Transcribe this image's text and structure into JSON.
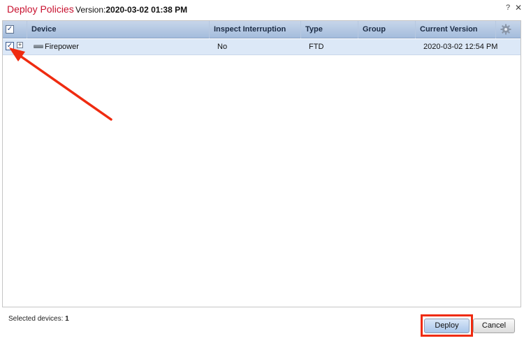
{
  "window": {
    "title": "Deploy Policies",
    "version_label": "Version:",
    "version_value": "2020-03-02 01:38 PM",
    "help_glyph": "?",
    "close_glyph": "✕"
  },
  "grid": {
    "select_all_checked": true,
    "check_glyph": "✓",
    "columns": [
      "Device",
      "Inspect Interruption",
      "Type",
      "Group",
      "Current Version"
    ],
    "rows": [
      {
        "checked": true,
        "device": "Firepower",
        "inspect_interruption": "No",
        "type": "FTD",
        "group": "",
        "current_version": "2020-03-02 12:54 PM"
      }
    ]
  },
  "footer": {
    "selected_label": "Selected devices:",
    "selected_count": "1",
    "deploy_label": "Deploy",
    "cancel_label": "Cancel"
  },
  "colors": {
    "title": "#c8102e",
    "header_bg": "#a4bcdc",
    "selected_row_bg": "#dce8f7",
    "annotation_red": "#ef2b10"
  },
  "icons": {
    "settings": "gear-icon",
    "expand": "plus-box-icon",
    "device": "device-icon"
  }
}
